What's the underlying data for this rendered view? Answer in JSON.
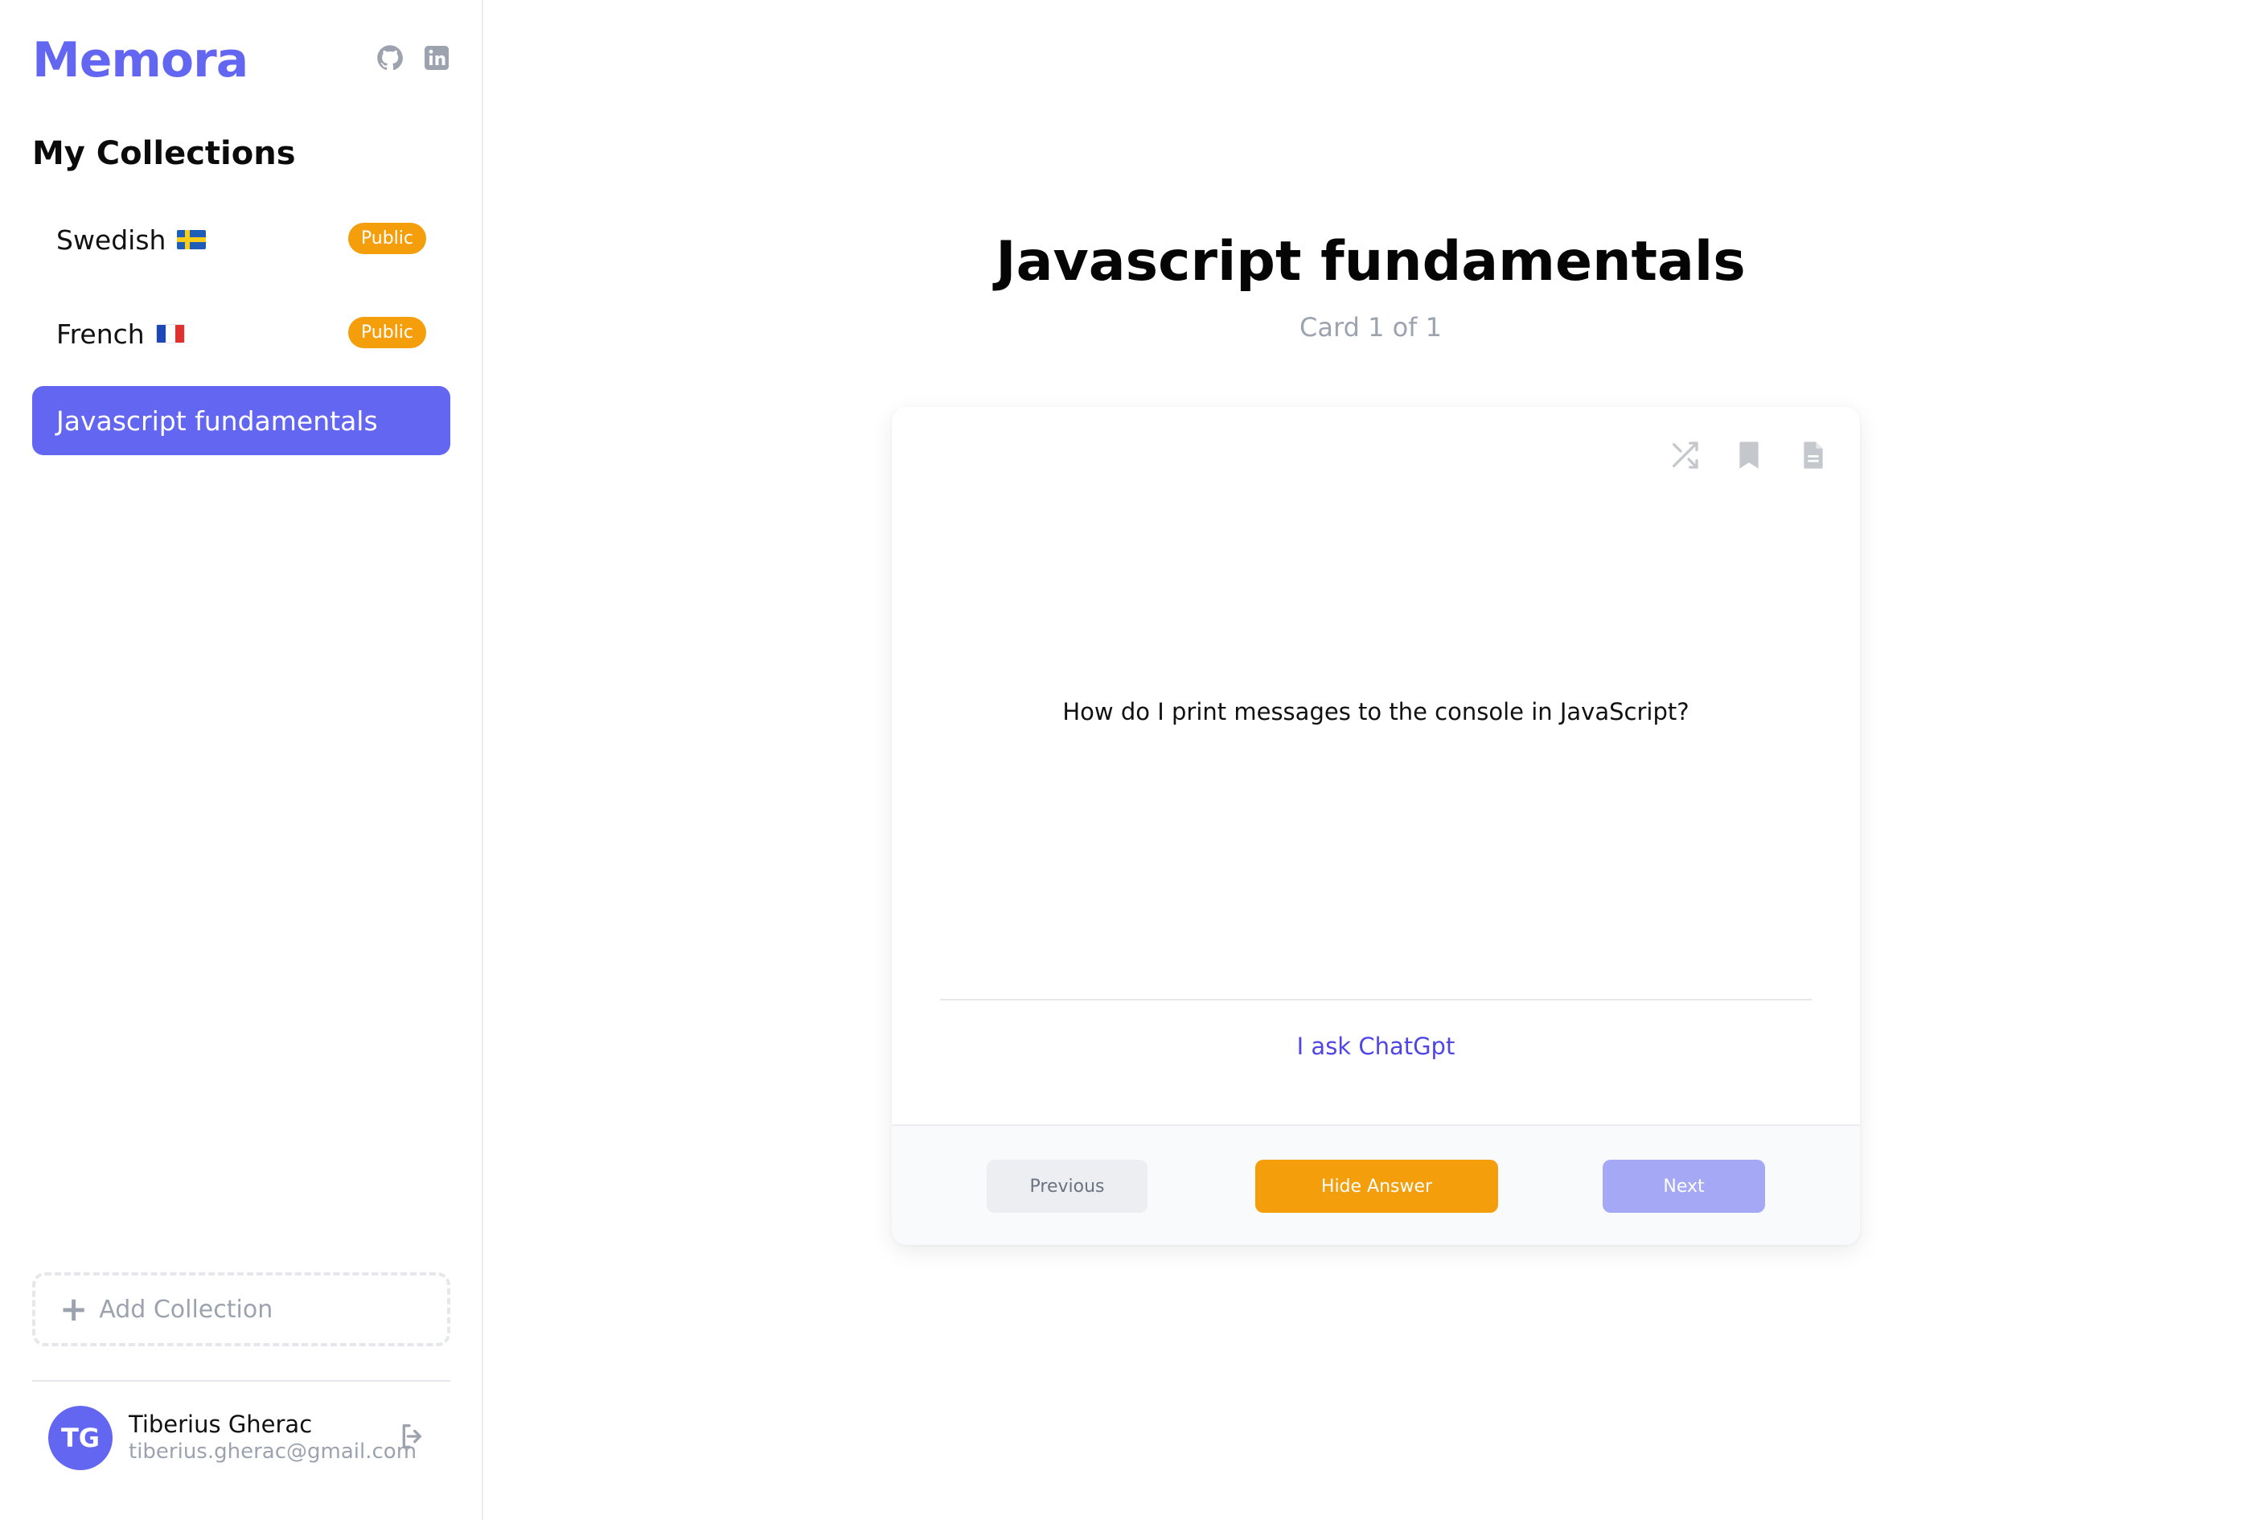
{
  "app": {
    "name": "Memora"
  },
  "sidebar": {
    "section_title": "My Collections",
    "collections": [
      {
        "label": "Swedish",
        "flag": "flag-sweden-icon",
        "badge": "Public",
        "active": false
      },
      {
        "label": "French",
        "flag": "flag-france-icon",
        "badge": "Public",
        "active": false
      },
      {
        "label": "Javascript fundamentals",
        "badge": "",
        "active": true
      }
    ],
    "add_collection_label": "Add Collection"
  },
  "user": {
    "initials": "TG",
    "name": "Tiberius Gherac",
    "email": "tiberius.gherac@gmail.com"
  },
  "main": {
    "title": "Javascript fundamentals",
    "card_count": "Card 1 of 1",
    "card": {
      "question": "How do I print messages to the console in JavaScript?",
      "answer": "I ask ChatGpt"
    },
    "buttons": {
      "previous": "Previous",
      "hide_answer": "Hide Answer",
      "next": "Next"
    }
  },
  "colors": {
    "accent": "#6366f1",
    "badge": "#f59e0b",
    "answer_text": "#4f46e5"
  }
}
